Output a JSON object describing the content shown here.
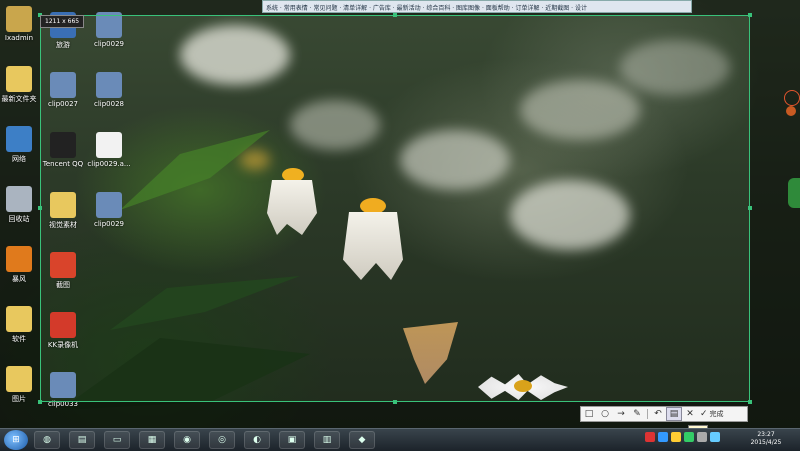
{
  "topbar": {
    "text": "系统 · 常用表情 · 常见问题 · 清单详解 · 广告库 · 最新活动 · 综合百科 · 图库图像 · 面板帮助 · 订单详解 · 近期截图 · 设计"
  },
  "selection": {
    "dimensions": "1211 x 665"
  },
  "desktop_icons": [
    {
      "label": "Ixadmin",
      "color": "#c9a64c"
    },
    {
      "label": "旅游",
      "color": "#3a6fb5"
    },
    {
      "label": "clip0029",
      "color": "#6a8bb8"
    },
    {
      "label": "最新文件夹",
      "color": "#e8c85e"
    },
    {
      "label": "clip0027",
      "color": "#6a8bb8"
    },
    {
      "label": "网络",
      "color": "#3d7fc6"
    },
    {
      "label": "Tencent QQ",
      "color": "#222222"
    },
    {
      "label": "clip0028",
      "color": "#6a8bb8"
    },
    {
      "label": "回收站",
      "color": "#aab4c0"
    },
    {
      "label": "视觉素材",
      "color": "#e8c85e"
    },
    {
      "label": "clip0029.a...",
      "color": "#f2f2f2"
    },
    {
      "label": "截图",
      "color": "#d9442b"
    },
    {
      "label": "暴风",
      "color": "#e07a1c"
    },
    {
      "label": "clip0029",
      "color": "#6a8bb8"
    },
    {
      "label": "软件",
      "color": "#e8c85e"
    },
    {
      "label": "KK录像机",
      "color": "#d33a2a"
    },
    {
      "label": "图片",
      "color": "#e8c85e"
    },
    {
      "label": "clip0033",
      "color": "#6a8bb8"
    }
  ],
  "toolbar": {
    "rect_icon": "□",
    "ellipse_icon": "○",
    "arrow_icon": "→",
    "pen_icon": "✎",
    "undo_icon": "↶",
    "save_icon": "▤",
    "cancel_icon": "✕",
    "done_icon": "✓",
    "done_label": "完成",
    "tooltip": "保存"
  },
  "taskbar": {
    "start_icon": "⊞",
    "buttons": [
      "◍",
      "▤",
      "▭",
      "▦",
      "◉",
      "◎",
      "◐",
      "▣",
      "▥",
      "◆"
    ],
    "clock_time": "23:27",
    "clock_date": "2015/4/25"
  },
  "colors": {
    "selection_border": "#39c27a",
    "taskbar": "#1c232a",
    "tooltip_bg": "#fff8d0"
  }
}
